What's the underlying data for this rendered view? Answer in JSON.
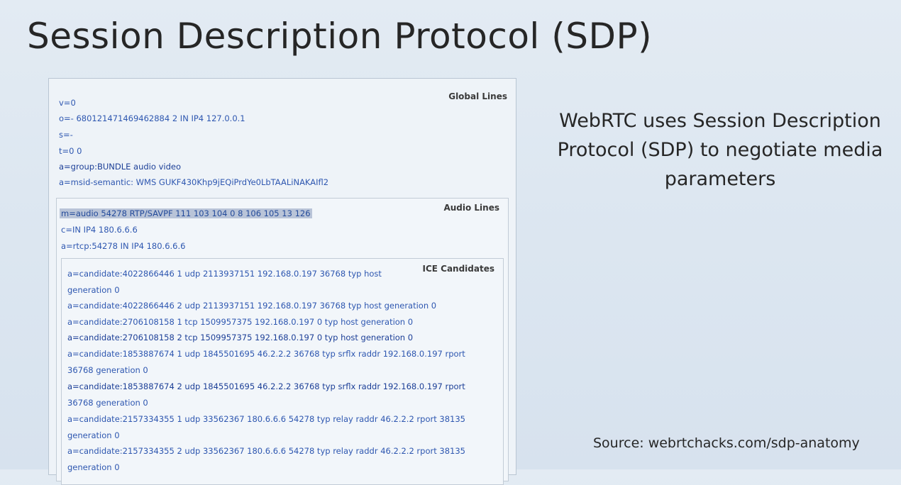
{
  "slide": {
    "title": "Session Description Protocol (SDP)",
    "description": "WebRTC uses Session Description Protocol (SDP) to negotiate media parameters",
    "source": "Source: webrtchacks.com/sdp-anatomy"
  },
  "sdp": {
    "global": {
      "label": "Global Lines",
      "lines": [
        "v=0",
        "o=- 680121471469462884 2 IN IP4 127.0.0.1",
        "s=-",
        "t=0 0",
        "a=group:BUNDLE audio video",
        "a=msid-semantic: WMS GUKF430Khp9jEQiPrdYe0LbTAALiNAKAIfl2"
      ]
    },
    "audio": {
      "label": "Audio Lines",
      "lines": [
        "m=audio 54278 RTP/SAVPF 111 103 104 0 8 106 105 13 126",
        "c=IN IP4 180.6.6.6",
        "a=rtcp:54278 IN IP4 180.6.6.6"
      ]
    },
    "ice": {
      "label": "ICE Candidates",
      "lines": [
        "a=candidate:4022866446 1 udp 2113937151 192.168.0.197 36768 typ host",
        "generation 0",
        "a=candidate:4022866446 2 udp 2113937151 192.168.0.197 36768 typ host generation 0",
        "a=candidate:2706108158 1 tcp 1509957375 192.168.0.197 0 typ host generation 0",
        "a=candidate:2706108158 2 tcp 1509957375 192.168.0.197 0 typ host generation 0",
        "a=candidate:1853887674 1 udp 1845501695 46.2.2.2 36768 typ srflx raddr 192.168.0.197 rport",
        "36768 generation 0",
        "a=candidate:1853887674 2 udp 1845501695 46.2.2.2 36768 typ srflx raddr 192.168.0.197 rport",
        "36768 generation 0",
        "a=candidate:2157334355 1 udp 33562367 180.6.6.6 54278 typ relay raddr 46.2.2.2 rport 38135",
        "generation 0",
        "a=candidate:2157334355 2 udp 33562367 180.6.6.6 54278 typ relay raddr 46.2.2.2 rport 38135",
        "generation 0"
      ]
    }
  }
}
